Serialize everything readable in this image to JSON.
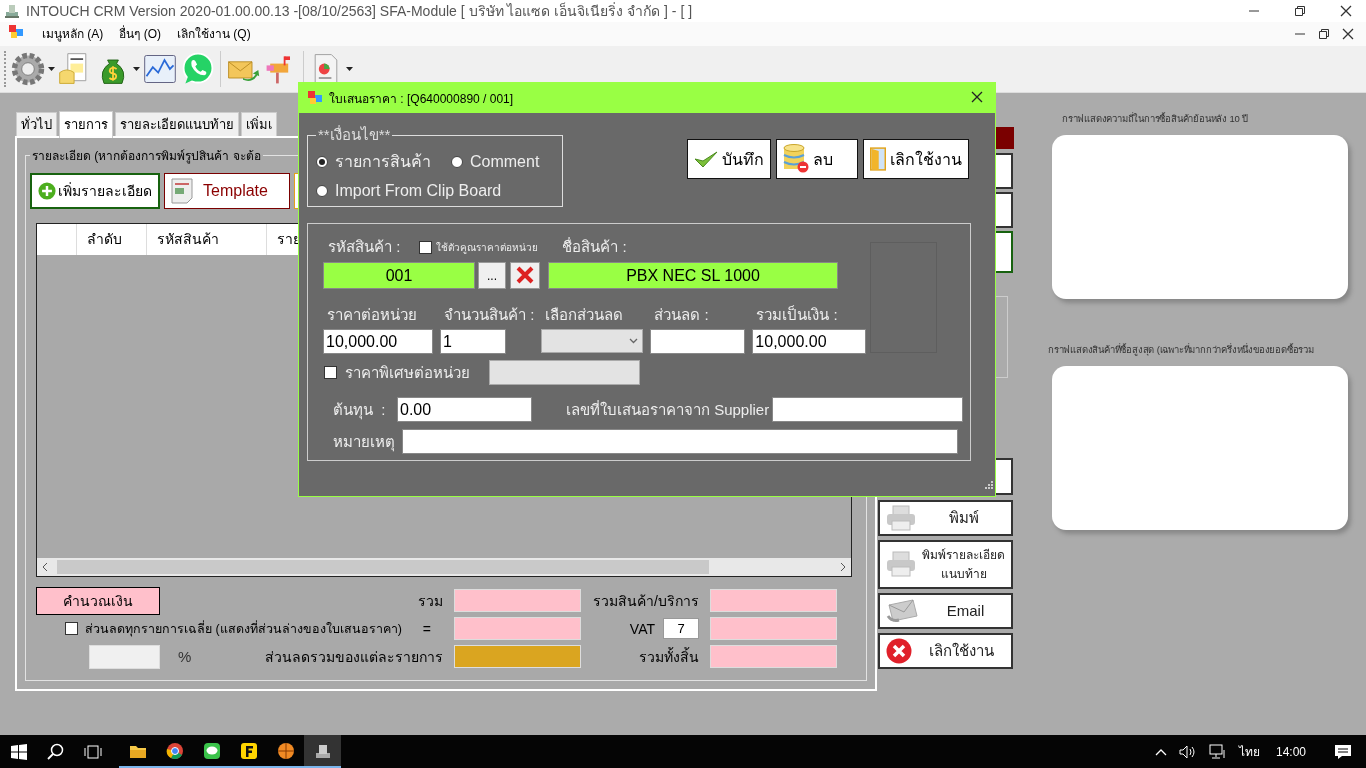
{
  "window": {
    "title": "INTOUCH CRM Version 2020-01.00.00.13 -[08/10/2563] SFA-Module  [ บริษัท ไอแซด เอ็นจิเนียริ่ง จำกัด ] - [ ]"
  },
  "menu": [
    "เมนูหลัก (A)",
    "อื่นๆ (O)",
    "เลิกใช้งาน (Q)"
  ],
  "tabs": [
    {
      "label": "ทั่วไป",
      "selected": false
    },
    {
      "label": "รายการ",
      "selected": true
    },
    {
      "label": "รายละเอียดแนบท้าย",
      "selected": false
    },
    {
      "label": "เพิ่มเ",
      "selected": false
    }
  ],
  "detail": {
    "title": "รายละเอียด (หากต้องการพิมพ์รูปสินค้า จะต้อ",
    "buttons": [
      {
        "label": "เพิ่มรายละเอียด",
        "kind": "add"
      },
      {
        "label": "Template",
        "kind": "template"
      }
    ],
    "table": {
      "columns": [
        "ลำดับ",
        "รหัสสินค้า",
        "ราย"
      ]
    }
  },
  "totals": {
    "calc_button": "คำนวณเงิน",
    "sum_label": "รวม",
    "equals_label": "=",
    "item_discount_label": "ส่วนลดรวมของแต่ละรายการ",
    "average_discount": {
      "label": "ส่วนลดทุกรายการเฉลี่ย (แสดงที่ส่วนล่างของใบเสนอราคา)",
      "checked": false
    },
    "percent_label": "%",
    "goods_label": "รวมสินค้า/บริการ",
    "vat_label": "VAT",
    "vat_rate": "7",
    "grand_total_label": "รวมทั้งสิ้น"
  },
  "side_buttons": [
    {
      "label": "พิมพ์",
      "kind": "print"
    },
    {
      "label": "พิมพ์รายละเอียด แนบท้าย",
      "kind": "print"
    },
    {
      "label": "Email",
      "kind": "email"
    },
    {
      "label": "เลิกใช้งาน",
      "kind": "cancel"
    }
  ],
  "charts": [
    {
      "title": "กราฟแสดงความถี่ในการซื้อสินค้าย้อนหลัง 10 ปี"
    },
    {
      "title": "กราฟแสดงสินค้าที่ซื้อสูงสุด (เฉพาะที่มากกว่าครึ่งหนึ่งของยอดซื้อรวม"
    }
  ],
  "dialog": {
    "title": "ใบเสนอราคา : [Q640000890 / 001]",
    "group_title": "**เงื่อนไข**",
    "options": [
      {
        "label": "รายการสินค้า",
        "selected": true
      },
      {
        "label": "Comment",
        "selected": false
      },
      {
        "label": "Import From Clip Board",
        "selected": false
      }
    ],
    "buttons": [
      {
        "label": "บันทึก",
        "kind": "save"
      },
      {
        "label": "ลบ",
        "kind": "delete"
      },
      {
        "label": "เลิกใช้งาน",
        "kind": "exit"
      }
    ],
    "product_code": {
      "label": "รหัสสินค้า :",
      "value": "001",
      "browse": "..."
    },
    "unit_multiplier": {
      "label": "ใช้ตัวคูณราคาต่อหน่วย",
      "checked": false
    },
    "product_name": {
      "label": "ชื่อสินค้า :",
      "value": "PBX NEC SL 1000"
    },
    "price_fields": [
      {
        "kind": "text",
        "label": "ราคาต่อหน่วย",
        "value": "10,000.00"
      },
      {
        "kind": "text",
        "label": "จำนวนสินค้า :",
        "value": "1"
      },
      {
        "kind": "select",
        "label": "เลือกส่วนลด",
        "disabled": true
      },
      {
        "kind": "text",
        "label": "ส่วนลด :"
      },
      {
        "kind": "text",
        "label": "รวมเป็นเงิน :",
        "value": "10,000.00"
      }
    ],
    "special_price": {
      "label": "ราคาพิเศษต่อหน่วย",
      "checked": false,
      "disabled": true
    },
    "cost": {
      "label": "ต้นทุน  :",
      "value": "0.00"
    },
    "supplier_quote": {
      "label": "เลขที่ใบเสนอราคาจาก Supplier"
    },
    "remark": {
      "label": "หมายเหตุ"
    }
  },
  "taskbar": {
    "language": "ไทย",
    "clock": "14:00"
  }
}
